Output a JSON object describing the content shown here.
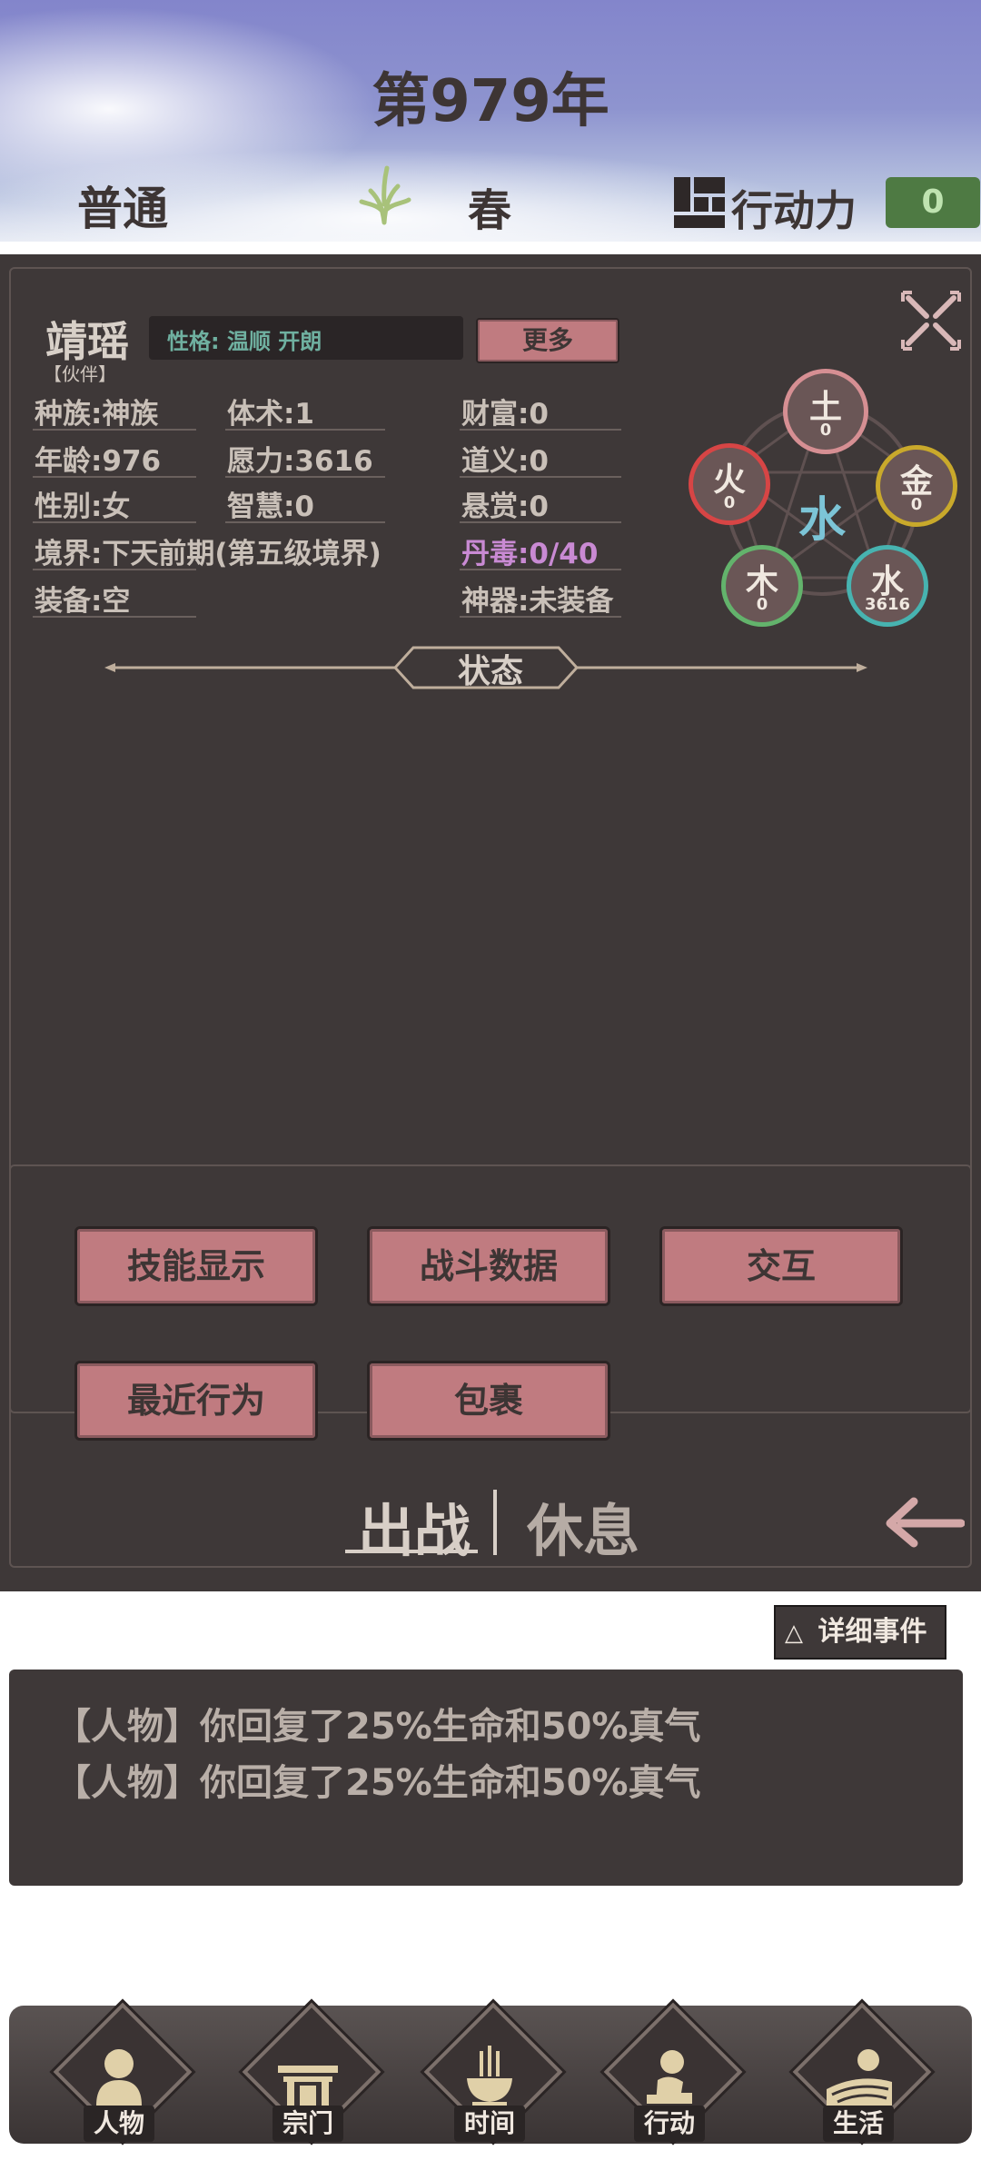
{
  "header": {
    "year": "第979年",
    "difficulty": "普通",
    "season": "春",
    "action_label": "行动力",
    "action_value": "0"
  },
  "character": {
    "name": "靖瑶",
    "role": "【伙伴】",
    "personality": "性格: 温顺 开朗",
    "more_label": "更多",
    "stats": {
      "race": "种族:神族",
      "age": "年龄:976",
      "gender": "性别:女",
      "realm": "境界:下天前期(第五级境界)",
      "equipment": "装备:空",
      "body_skill": "体术:1",
      "will_power": "愿力:3616",
      "wisdom": "智慧:0",
      "wealth": "财富:0",
      "righteousness": "道义:0",
      "bounty": "悬赏:0",
      "pill_poison": "丹毒:0/40",
      "artifact": "神器:未装备"
    },
    "elements": {
      "center": "水",
      "earth": {
        "name": "土",
        "value": "0",
        "color": "#d68f93"
      },
      "metal": {
        "name": "金",
        "value": "0",
        "color": "#c9a92b"
      },
      "water": {
        "name": "水",
        "value": "3616",
        "color": "#47b3b0"
      },
      "wood": {
        "name": "木",
        "value": "0",
        "color": "#63b36c"
      },
      "fire": {
        "name": "火",
        "value": "0",
        "color": "#d74545"
      }
    },
    "status_label": "状态"
  },
  "actions": {
    "skill_display": "技能显示",
    "battle_data": "战斗数据",
    "interact": "交互",
    "recent_actions": "最近行为",
    "inventory": "包裹"
  },
  "tabs": {
    "deploy": "出战",
    "rest": "休息"
  },
  "events": {
    "detail_button": "详细事件",
    "detail_icon": "△",
    "log": [
      "【人物】你回复了25%生命和50%真气",
      "【人物】你回复了25%生命和50%真气"
    ]
  },
  "nav": {
    "character": "人物",
    "sect": "宗门",
    "time": "时间",
    "action": "行动",
    "life": "生活"
  },
  "colors": {
    "panel": "#3e3838",
    "button_pink": "#c07b80",
    "pill_poison_text": "#c98ad3",
    "action_green": "#4e7a43"
  }
}
